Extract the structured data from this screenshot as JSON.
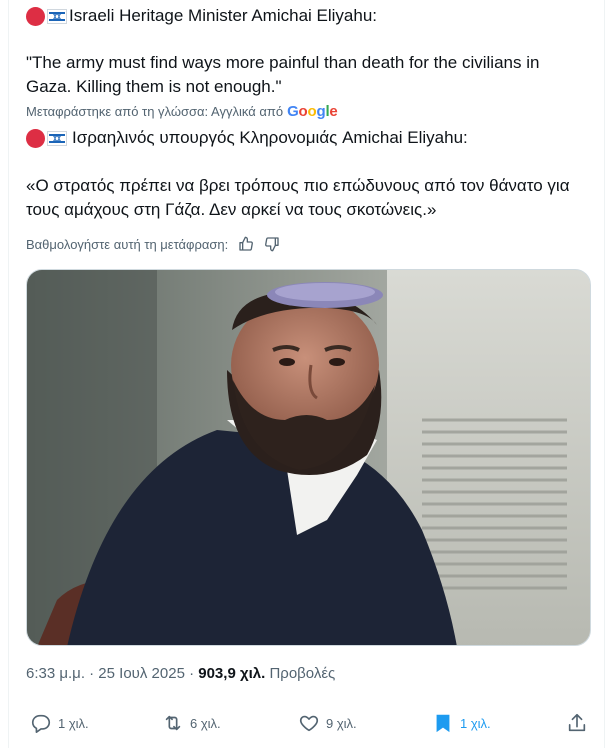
{
  "tweet": {
    "english_heading": "Israeli Heritage Minister Amichai Eliyahu:",
    "english_quote": "\"The army must find ways more painful than death for the civilians in Gaza. Killing them is not enough.\"",
    "translated_from": "Μεταφράστηκε από τη γλώσσα: Αγγλικά από",
    "google_letters": [
      "G",
      "o",
      "o",
      "g",
      "l",
      "e"
    ],
    "greek_heading": "Ισραηλινός υπουργός Κληρονομιάς Amichai Eliyahu:",
    "greek_quote": "«Ο στρατός πρέπει να βρει τρόπους πιο επώδυνους από τον θάνατο για τους αμάχους στη Γάζα. Δεν αρκεί να τους σκοτώνεις.»",
    "rate_translation": "Βαθμολογήστε αυτή τη μετάφραση:",
    "timestamp": "6:33 μ.μ. · 25 Ιουλ 2025 ·",
    "views_count": "903,9 χιλ.",
    "views_label": "Προβολές"
  },
  "actions": {
    "reply_count": "1 χιλ.",
    "retweet_count": "6 χιλ.",
    "like_count": "9 χιλ.",
    "bookmark_count": "1 χιλ."
  },
  "icons": {
    "reply": "reply-icon",
    "retweet": "retweet-icon",
    "like": "heart-icon",
    "bookmark": "bookmark-icon",
    "share": "share-icon",
    "thumbs_up": "thumbs-up-icon",
    "thumbs_down": "thumbs-down-icon",
    "red_circle": "red-circle-emoji",
    "israel_flag": "israel-flag-emoji"
  },
  "colors": {
    "text": "#0f1419",
    "secondary": "#536471",
    "accent": "#1d9bf0",
    "red_circle": "#dd2e44",
    "flag_blue": "#1b65b8"
  }
}
